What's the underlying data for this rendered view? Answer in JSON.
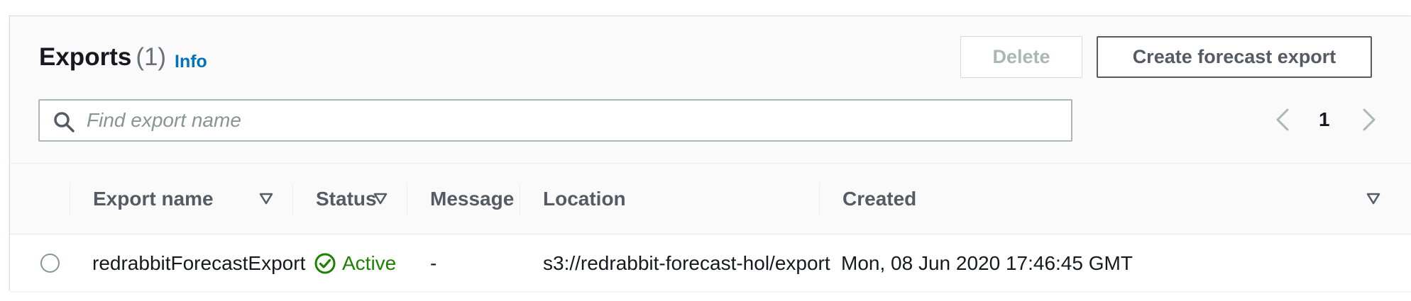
{
  "header": {
    "title": "Exports",
    "count": "(1)",
    "info_link": "Info",
    "delete_label": "Delete",
    "create_label": "Create forecast export"
  },
  "search": {
    "placeholder": "Find export name",
    "value": ""
  },
  "pagination": {
    "current_page": "1"
  },
  "table": {
    "columns": [
      "Export name",
      "Status",
      "Message",
      "Location",
      "Created"
    ],
    "rows": [
      {
        "selected": false,
        "export_name": "redrabbitForecastExport",
        "status": "Active",
        "message": "-",
        "location": "s3://redrabbit-forecast-hol/export",
        "created": "Mon, 08 Jun 2020 17:46:45 GMT"
      }
    ]
  },
  "colors": {
    "accent_link": "#0073bb",
    "status_active": "#1d8102",
    "border": "#d5dbdb",
    "header_bg": "#fafafa"
  },
  "icons": {
    "search": "search-icon",
    "prev": "chevron-left-icon",
    "next": "chevron-right-icon",
    "sort": "sort-caret-icon",
    "status": "check-circle-icon"
  }
}
